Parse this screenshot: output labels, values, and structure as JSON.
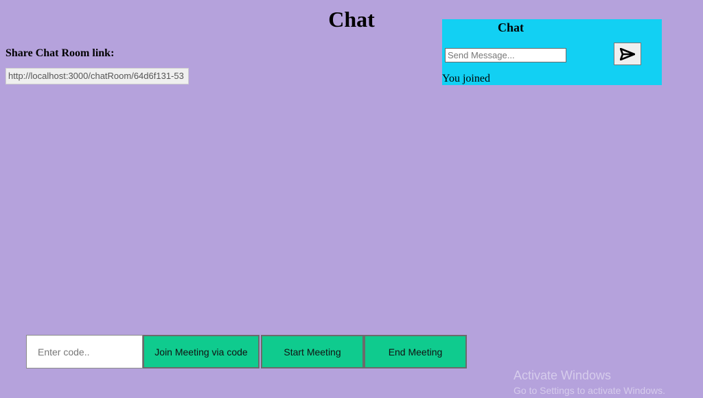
{
  "page": {
    "title": "Chat"
  },
  "share": {
    "label": "Share Chat Room link:",
    "link": "http://localhost:3000/chatRoom/64d6f131-53"
  },
  "chat": {
    "heading": "Chat",
    "message_placeholder": "Send Message...",
    "send_icon": "send-arrow-icon",
    "status": "You joined"
  },
  "meeting": {
    "code_placeholder": "Enter code..",
    "join_label": "Join Meeting via code",
    "start_label": "Start Meeting",
    "end_label": "End Meeting"
  },
  "watermark": {
    "title": "Activate Windows",
    "subtitle": "Go to Settings to activate Windows."
  },
  "colors": {
    "background": "#b5a2dc",
    "chat_panel": "#12d0f3",
    "meeting_button": "#0fcb8e"
  }
}
